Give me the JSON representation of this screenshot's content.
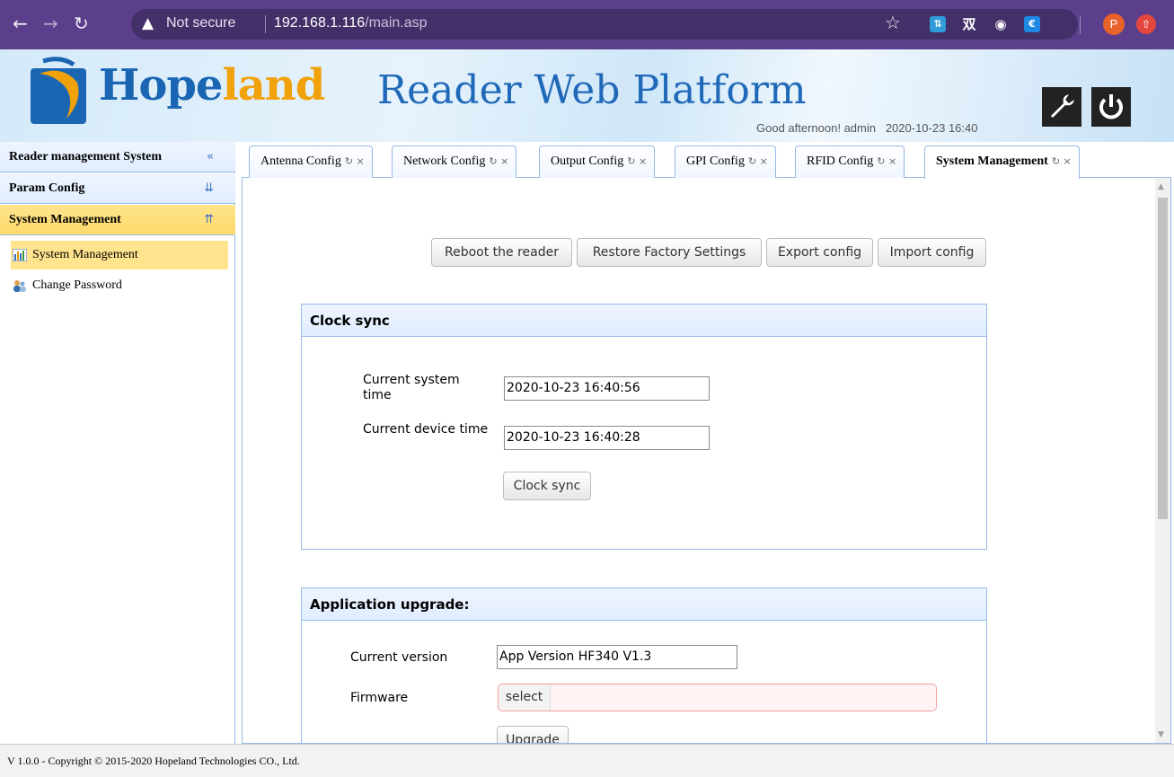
{
  "browser": {
    "security_label": "Not secure",
    "url_host": "192.168.1.116",
    "url_path": "/main.asp",
    "profile_initial": "P",
    "extensions": [
      "translate-icon",
      "dict-icon",
      "box-icon",
      "wallet-icon"
    ],
    "ext_dict_label": "双"
  },
  "header": {
    "logo_prefix": "Hope",
    "logo_suffix": "land",
    "title": "Reader Web Platform",
    "greeting": "Good afternoon! admin",
    "datetime": "2020-10-23 16:40"
  },
  "sidebar": {
    "sections": [
      {
        "label": "Reader management System",
        "icon": "double-chevron-left-icon"
      },
      {
        "label": "Param Config",
        "icon": "double-chevron-down-icon"
      },
      {
        "label": "System Management",
        "icon": "double-chevron-up-icon"
      }
    ],
    "items": [
      {
        "label": "System Management",
        "icon": "chart-icon",
        "selected": true
      },
      {
        "label": "Change Password",
        "icon": "users-icon",
        "selected": false
      }
    ]
  },
  "tabs": [
    {
      "label": "Antenna Config"
    },
    {
      "label": "Network Config"
    },
    {
      "label": "Output Config"
    },
    {
      "label": "GPI Config"
    },
    {
      "label": "RFID Config"
    },
    {
      "label": "System Management",
      "active": true
    }
  ],
  "tab_controls": "↻ ×",
  "actions": {
    "reboot": "Reboot the reader",
    "restore": "Restore Factory Settings",
    "export": "Export config",
    "import": "Import config"
  },
  "clock_sync": {
    "title": "Clock sync",
    "system_time_label": "Current system time",
    "system_time_value": "2020-10-23 16:40:56",
    "device_time_label": "Current device time",
    "device_time_value": "2020-10-23 16:40:28",
    "sync_button": "Clock sync"
  },
  "upgrade": {
    "title": "Application upgrade:",
    "version_label": "Current version",
    "version_value": "App Version HF340 V1.3",
    "firmware_label": "Firmware",
    "select_button": "select",
    "upgrade_button": "Upgrade"
  },
  "footer": {
    "text": "V 1.0.0 - Copyright © 2015-2020 Hopeland Technologies CO., Ltd."
  },
  "colors": {
    "chrome": "#5b3f8c",
    "panel_border": "#95b8e7",
    "selected": "#ffe48d",
    "brand_blue": "#1a66b3",
    "brand_orange": "#f1a20a"
  }
}
